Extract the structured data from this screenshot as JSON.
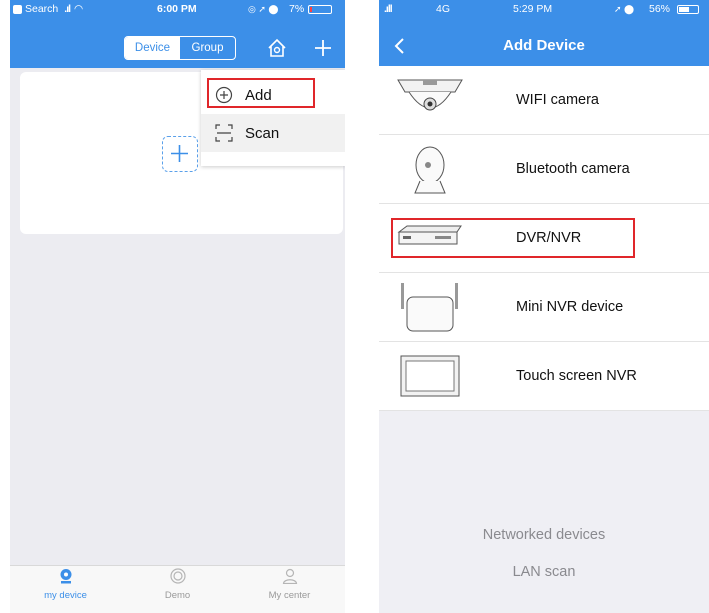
{
  "left_screen": {
    "status": {
      "search": "Search",
      "time": "6:00 PM",
      "battery": "7%"
    },
    "segmented": {
      "device": "Device",
      "group": "Group"
    },
    "menu": {
      "add": "Add",
      "scan": "Scan"
    },
    "tabs": [
      {
        "label": "my device",
        "icon": "camera-icon",
        "active": true
      },
      {
        "label": "Demo",
        "icon": "demo-icon",
        "active": false
      },
      {
        "label": "My center",
        "icon": "person-icon",
        "active": false
      }
    ],
    "colors": {
      "header": "#3c8fe8",
      "highlight": "#e0262a"
    }
  },
  "right_screen": {
    "status": {
      "carrier": "4G",
      "time": "5:29 PM",
      "battery": "56%"
    },
    "title": "Add Device",
    "devices": [
      {
        "name": "WIFI camera",
        "icon": "dome-camera-icon"
      },
      {
        "name": "Bluetooth camera",
        "icon": "bluetooth-camera-icon"
      },
      {
        "name": "DVR/NVR",
        "icon": "dvr-icon",
        "highlighted": true
      },
      {
        "name": "Mini NVR device",
        "icon": "mini-nvr-icon"
      },
      {
        "name": "Touch screen NVR",
        "icon": "touch-nvr-icon"
      }
    ],
    "bottom": {
      "networked": "Networked devices",
      "lan": "LAN scan"
    }
  }
}
